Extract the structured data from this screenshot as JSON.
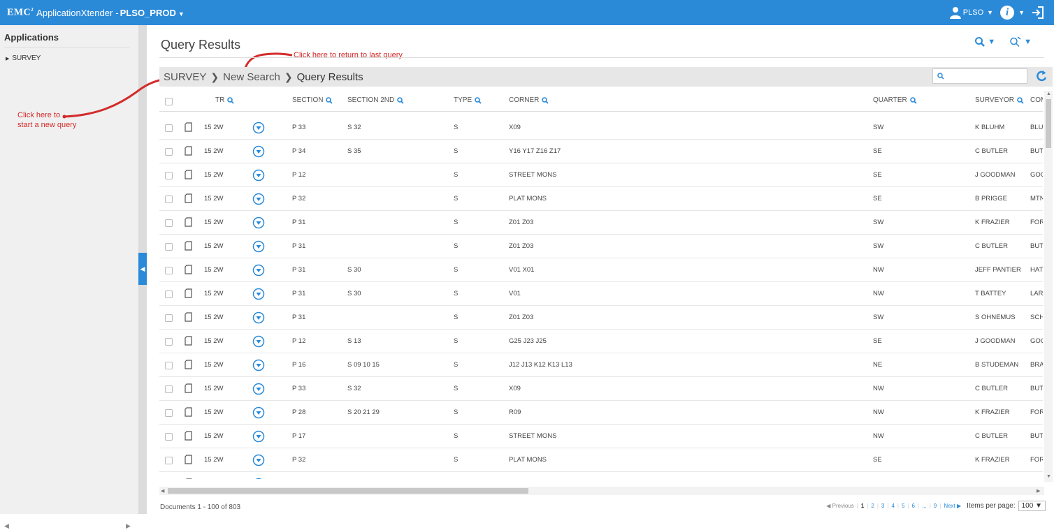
{
  "app": {
    "brand": "EMC",
    "brand_mark": "2",
    "name": "ApplicationXtender",
    "separator": "-",
    "environment": "PLSO_PROD",
    "user": "PLSO"
  },
  "sidebar": {
    "title": "Applications",
    "items": [
      {
        "label": "SURVEY"
      }
    ]
  },
  "annotations": {
    "return_query": "Click here to return to last query",
    "new_query_line1": "Click here to",
    "new_query_line2": "start a new query"
  },
  "page": {
    "title": "Query Results",
    "breadcrumb": [
      "SURVEY",
      "New Search",
      "Query Results"
    ]
  },
  "columns": {
    "tr": "TR",
    "section": "SECTION",
    "section2": "SECTION 2ND",
    "type": "TYPE",
    "corner": "CORNER",
    "quarter": "QUARTER",
    "surveyor": "SURVEYOR",
    "com": "COM"
  },
  "rows": [
    {
      "tr": "15 2W",
      "section": "P 33",
      "section2": "S 32",
      "type": "S",
      "corner": "X09",
      "quarter": "SW",
      "surveyor": "K BLUHM",
      "com": "BLU"
    },
    {
      "tr": "15 2W",
      "section": "P 34",
      "section2": "S 35",
      "type": "S",
      "corner": "Y16 Y17 Z16 Z17",
      "quarter": "SE",
      "surveyor": "C BUTLER",
      "com": "BUT"
    },
    {
      "tr": "15 2W",
      "section": "P 12",
      "section2": "",
      "type": "S",
      "corner": "STREET MONS",
      "quarter": "SE",
      "surveyor": "J GOODMAN",
      "com": "GOC"
    },
    {
      "tr": "15 2W",
      "section": "P 32",
      "section2": "",
      "type": "S",
      "corner": "PLAT MONS",
      "quarter": "SE",
      "surveyor": "B PRIGGE",
      "com": "MTN"
    },
    {
      "tr": "15 2W",
      "section": "P 31",
      "section2": "",
      "type": "S",
      "corner": "Z01 Z03",
      "quarter": "SW",
      "surveyor": "K FRAZIER",
      "com": "FOR"
    },
    {
      "tr": "15 2W",
      "section": "P 31",
      "section2": "",
      "type": "S",
      "corner": "Z01 Z03",
      "quarter": "SW",
      "surveyor": "C BUTLER",
      "com": "BUT"
    },
    {
      "tr": "15 2W",
      "section": "P 31",
      "section2": "S 30",
      "type": "S",
      "corner": "V01 X01",
      "quarter": "NW",
      "surveyor": "JEFF PANTIER",
      "com": "HAT"
    },
    {
      "tr": "15 2W",
      "section": "P 31",
      "section2": "S 30",
      "type": "S",
      "corner": "V01",
      "quarter": "NW",
      "surveyor": "T BATTEY",
      "com": "LAR"
    },
    {
      "tr": "15 2W",
      "section": "P 31",
      "section2": "",
      "type": "S",
      "corner": "Z01 Z03",
      "quarter": "SW",
      "surveyor": "S OHNEMUS",
      "com": "SCH"
    },
    {
      "tr": "15 2W",
      "section": "P 12",
      "section2": "S 13",
      "type": "S",
      "corner": "G25 J23 J25",
      "quarter": "SE",
      "surveyor": "J GOODMAN",
      "com": "GOC"
    },
    {
      "tr": "15 2W",
      "section": "P 16",
      "section2": "S 09 10 15",
      "type": "S",
      "corner": "J12 J13 K12 K13 L13",
      "quarter": "NE",
      "surveyor": "B STUDEMAN",
      "com": "BRA"
    },
    {
      "tr": "15 2W",
      "section": "P 33",
      "section2": "S 32",
      "type": "S",
      "corner": "X09",
      "quarter": "NW",
      "surveyor": "C BUTLER",
      "com": "BUT"
    },
    {
      "tr": "15 2W",
      "section": "P 28",
      "section2": "S 20 21 29",
      "type": "S",
      "corner": "R09",
      "quarter": "NW",
      "surveyor": "K FRAZIER",
      "com": "FOR"
    },
    {
      "tr": "15 2W",
      "section": "P 17",
      "section2": "",
      "type": "S",
      "corner": "STREET MONS",
      "quarter": "NW",
      "surveyor": "C BUTLER",
      "com": "BUT"
    },
    {
      "tr": "15 2W",
      "section": "P 32",
      "section2": "",
      "type": "S",
      "corner": "PLAT MONS",
      "quarter": "SE",
      "surveyor": "K FRAZIER",
      "com": "FOR"
    }
  ],
  "footer": {
    "documents": "Documents 1 - 100 of 803",
    "prev": "◀ Previous",
    "pages": [
      "1",
      "2",
      "3",
      "4",
      "5",
      "6",
      "...",
      "9"
    ],
    "next": "Next ▶",
    "items_label": "Items per page:",
    "items_value": "100"
  },
  "colors": {
    "accent": "#2b8ad8",
    "annotation": "#d42b2b"
  }
}
